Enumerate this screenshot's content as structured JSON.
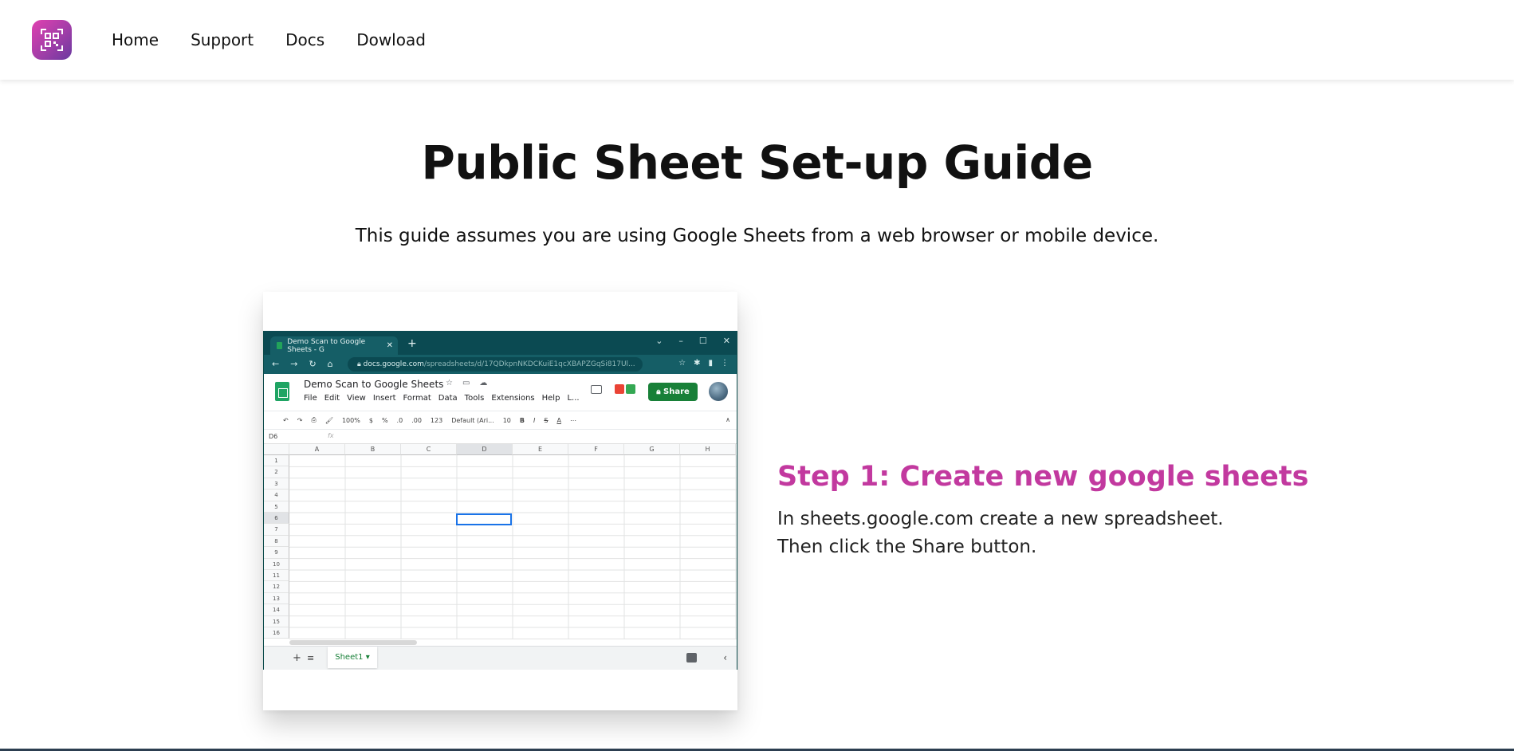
{
  "nav": {
    "items": [
      "Home",
      "Support",
      "Docs",
      "Dowload"
    ]
  },
  "hero": {
    "title": "Public Sheet Set-up Guide",
    "subtitle": "This guide assumes you are using Google Sheets from a web browser or mobile device."
  },
  "step1": {
    "title": "Step 1: Create new google sheets",
    "description": "In sheets.google.com create a new spreadsheet. Then click the Share button."
  },
  "screenshot": {
    "tab_title": "Demo Scan to Google Sheets - G",
    "url_host": "docs.google.com",
    "url_path": "/spreadsheets/d/17QDkpnNKDCKuiE1qcXBAPZGqSi817Ul...",
    "doc_title": "Demo Scan to Google Sheets",
    "menu": [
      "File",
      "Edit",
      "View",
      "Insert",
      "Format",
      "Data",
      "Tools",
      "Extensions",
      "Help",
      "L..."
    ],
    "share_label": "Share",
    "toolbar": [
      "100%",
      "$",
      "%",
      ".0",
      ".00",
      "123",
      "Default (Ari...",
      "10",
      "B",
      "I",
      "S",
      "A"
    ],
    "cell_ref": "D6",
    "fx": "fx",
    "columns": [
      "A",
      "B",
      "C",
      "D",
      "E",
      "F",
      "G",
      "H"
    ],
    "rows": [
      "1",
      "2",
      "3",
      "4",
      "5",
      "6",
      "7",
      "8",
      "9",
      "10",
      "11",
      "12",
      "13",
      "14",
      "15",
      "16"
    ],
    "sheet_tab": "Sheet1 ▾"
  },
  "colors": {
    "accent": "#c2399f",
    "share_green": "#188038",
    "browser_teal": "#0b4a52"
  }
}
